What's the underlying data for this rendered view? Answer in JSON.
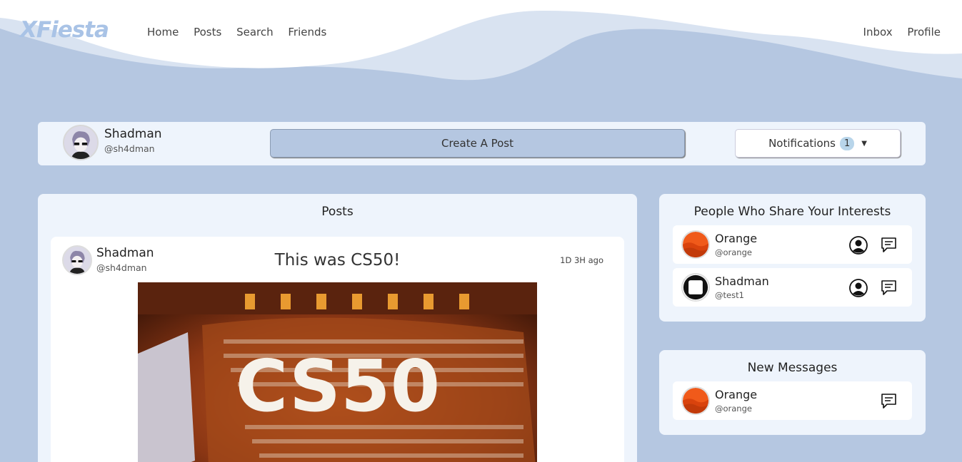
{
  "brand": {
    "logo": "XFiesta"
  },
  "nav": {
    "left": [
      "Home",
      "Posts",
      "Search",
      "Friends"
    ],
    "right": [
      "Inbox",
      "Profile"
    ]
  },
  "current_user": {
    "name": "Shadman",
    "handle": "@sh4dman"
  },
  "topbar": {
    "create_label": "Create A Post",
    "notifications_label": "Notifications",
    "notifications_count": "1"
  },
  "posts": {
    "title": "Posts",
    "items": [
      {
        "author": "Shadman",
        "handle": "@sh4dman",
        "title": "This was CS50!",
        "time": "1D 3H ago",
        "image_text": "CS50"
      }
    ]
  },
  "interests": {
    "title": "People Who Share Your Interests",
    "people": [
      {
        "name": "Orange",
        "handle": "@orange"
      },
      {
        "name": "Shadman",
        "handle": "@test1"
      }
    ]
  },
  "messages": {
    "title": "New Messages",
    "people": [
      {
        "name": "Orange",
        "handle": "@orange"
      }
    ]
  },
  "colors": {
    "background": "#b5c7e1",
    "panel": "#eef4fc",
    "accent": "#a9c3e6",
    "orange": "#f05a1a"
  },
  "icons": {
    "profile": "user-circle-icon",
    "chat": "chat-bubble-icon",
    "caret": "caret-down-icon"
  }
}
